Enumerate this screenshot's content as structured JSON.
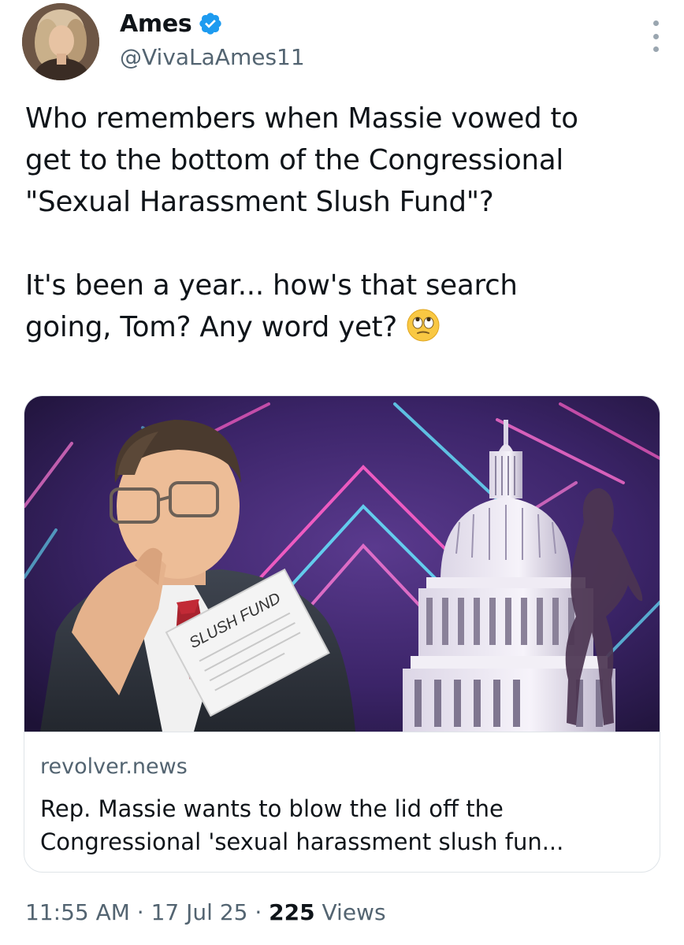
{
  "author": {
    "display_name": "Ames",
    "handle": "@VivaLaAmes11",
    "verified": true,
    "avatar_icon": "profile-photo"
  },
  "tweet": {
    "lines": [
      "Who remembers when Massie vowed to",
      "get to the bottom of the Congressional",
      "\"Sexual Harassment Slush Fund\"?",
      "",
      "It's been a year... how's that search",
      "going, Tom? Any word yet?"
    ],
    "emoji": "face-with-rolling-eyes"
  },
  "card": {
    "image_text": "SLUSH FUND",
    "domain": "revolver.news",
    "title_lines": [
      "Rep. Massie wants to blow the lid off the",
      "Congressional 'sexual harassment slush fun..."
    ]
  },
  "footer": {
    "time": "11:55 AM",
    "sep1": " · ",
    "date": "17 Jul 25",
    "sep2": " · ",
    "views_count": "225",
    "views_label": " Views"
  },
  "colors": {
    "accent_verified": "#1d9bf0",
    "text_primary": "#0f1419",
    "text_secondary": "#536471",
    "border": "#dfe4e8"
  }
}
